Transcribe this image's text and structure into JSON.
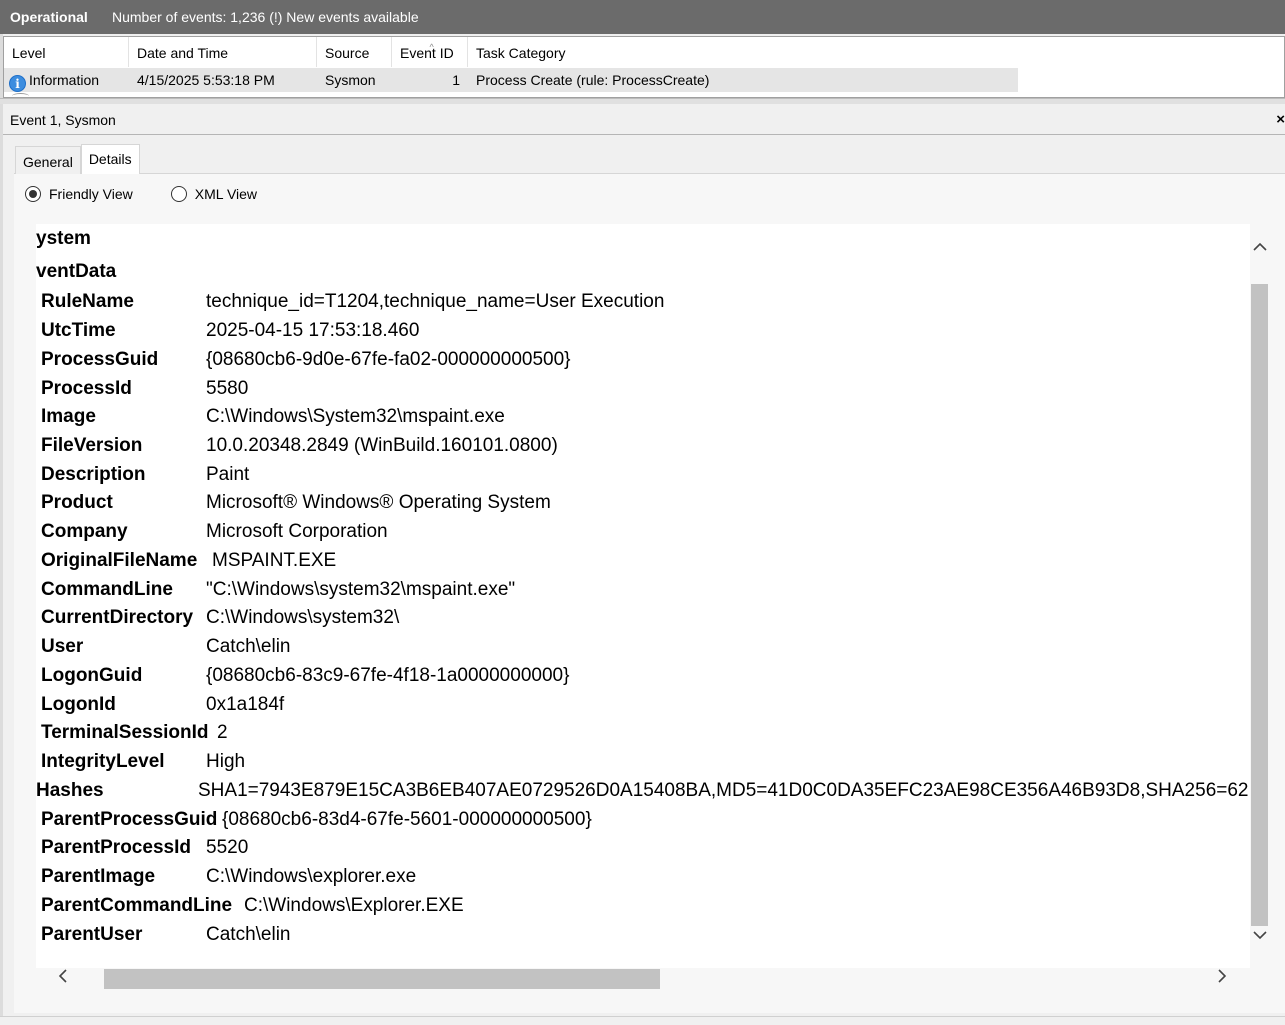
{
  "header": {
    "log_name": "Operational",
    "info": "Number of events: 1,236 (!) New events available"
  },
  "grid": {
    "columns": [
      "Level",
      "Date and Time",
      "Source",
      "Event ID",
      "Task Category"
    ],
    "row": {
      "level": "Information",
      "datetime": "4/15/2025 5:53:18 PM",
      "source": "Sysmon",
      "event_id": "1",
      "task_category": "Process Create (rule: ProcessCreate)"
    }
  },
  "details": {
    "title": "Event 1, Sysmon",
    "close": "×",
    "tabs": [
      "General",
      "Details"
    ],
    "views": [
      "Friendly View",
      "XML View"
    ],
    "sections": [
      "ystem",
      "ventData"
    ],
    "fields": [
      {
        "key": "RuleName",
        "value": "technique_id=T1204,technique_name=User Execution"
      },
      {
        "key": "UtcTime",
        "value": "2025-04-15 17:53:18.460"
      },
      {
        "key": "ProcessGuid",
        "value": "{08680cb6-9d0e-67fe-fa02-000000000500}"
      },
      {
        "key": "ProcessId",
        "value": "5580"
      },
      {
        "key": "Image",
        "value": "C:\\Windows\\System32\\mspaint.exe"
      },
      {
        "key": "FileVersion",
        "value": "10.0.20348.2849 (WinBuild.160101.0800)"
      },
      {
        "key": "Description",
        "value": "Paint"
      },
      {
        "key": "Product",
        "value": "Microsoft® Windows® Operating System"
      },
      {
        "key": "Company",
        "value": "Microsoft Corporation"
      },
      {
        "key": "OriginalFileName",
        "value": "MSPAINT.EXE"
      },
      {
        "key": "CommandLine",
        "value": "\"C:\\Windows\\system32\\mspaint.exe\""
      },
      {
        "key": "CurrentDirectory",
        "value": "C:\\Windows\\system32\\"
      },
      {
        "key": "User",
        "value": "Catch\\elin"
      },
      {
        "key": "LogonGuid",
        "value": "{08680cb6-83c9-67fe-4f18-1a0000000000}"
      },
      {
        "key": "LogonId",
        "value": "0x1a184f"
      },
      {
        "key": "TerminalSessionId",
        "value": "2"
      },
      {
        "key": "IntegrityLevel",
        "value": "High"
      },
      {
        "key": "Hashes",
        "value": "SHA1=7943E879E15CA3B6EB407AE0729526D0A15408BA,MD5=41D0C0DA35EFC23AE98CE356A46B93D8,SHA256=62"
      },
      {
        "key": "ParentProcessGuid",
        "value": "{08680cb6-83d4-67fe-5601-000000000500}"
      },
      {
        "key": "ParentProcessId",
        "value": "5520"
      },
      {
        "key": "ParentImage",
        "value": "C:\\Windows\\explorer.exe"
      },
      {
        "key": "ParentCommandLine",
        "value": "C:\\Windows\\Explorer.EXE"
      },
      {
        "key": "ParentUser",
        "value": "Catch\\elin"
      }
    ]
  }
}
